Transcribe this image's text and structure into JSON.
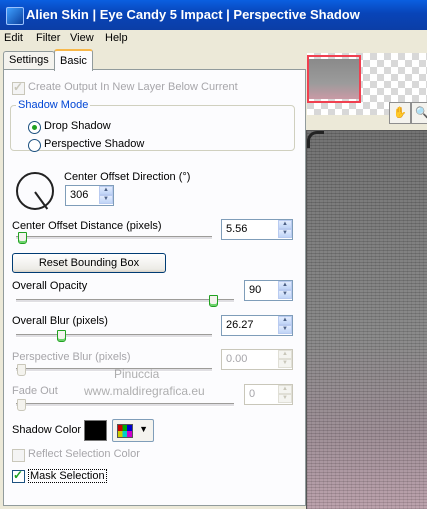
{
  "window": {
    "title": "Alien Skin | Eye Candy 5 Impact | Perspective Shadow"
  },
  "menu": {
    "edit": "Edit",
    "filter": "Filter",
    "view": "View",
    "help": "Help"
  },
  "tabs": {
    "settings": "Settings",
    "basic": "Basic"
  },
  "basic": {
    "create_output_label": "Create Output In New Layer Below Current",
    "create_output_checked": true,
    "shadow_mode": {
      "title": "Shadow Mode",
      "drop_shadow": "Drop Shadow",
      "perspective_shadow": "Perspective Shadow",
      "selected": "Drop Shadow"
    },
    "center_offset_direction": {
      "label": "Center Offset Direction (°)",
      "value": "306"
    },
    "center_offset_distance": {
      "label": "Center Offset Distance (pixels)",
      "value": "5.56"
    },
    "reset_bounding_box": "Reset Bounding Box",
    "overall_opacity": {
      "label": "Overall Opacity",
      "value": "90"
    },
    "overall_blur": {
      "label": "Overall Blur (pixels)",
      "value": "26.27"
    },
    "perspective_blur": {
      "label": "Perspective Blur (pixels)",
      "value": "0.00"
    },
    "fade_out": {
      "label": "Fade Out",
      "value": "0"
    },
    "shadow_color": {
      "label": "Shadow Color",
      "color": "#000000"
    },
    "reflect_selection_color": {
      "label": "Reflect Selection Color",
      "checked": false
    },
    "mask_selection": {
      "label": "Mask Selection",
      "checked": true
    }
  },
  "watermark": {
    "line1": "Pinuccia",
    "line2": "www.maldiregrafica.eu"
  },
  "colors": {
    "title_bar": "#0844b8",
    "accent_green": "#21a121",
    "group_label": "#0046d5"
  },
  "icons": [
    "app-icon",
    "hand-tool-icon",
    "zoom-tool-icon",
    "check-icon",
    "palette-icon",
    "chevron-down-icon"
  ]
}
